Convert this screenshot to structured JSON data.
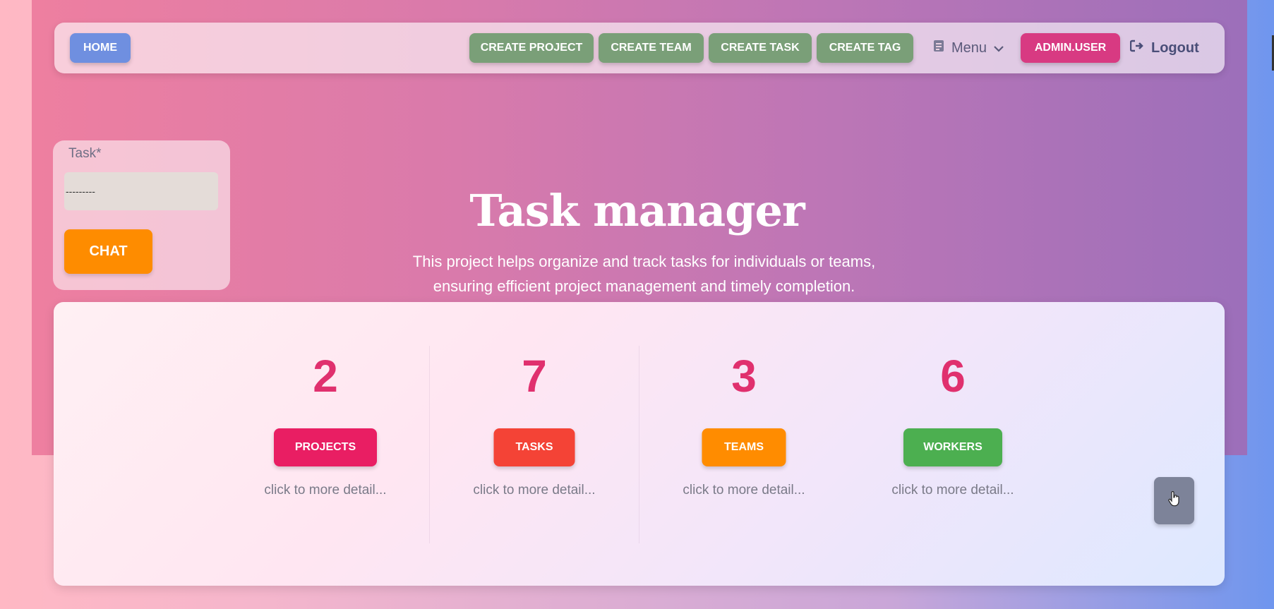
{
  "nav": {
    "home_label": "HOME",
    "actions": [
      "CREATE PROJECT",
      "CREATE TEAM",
      "CREATE TASK",
      "CREATE TAG"
    ],
    "menu_label": "Menu",
    "user_label": "ADMIN.USER",
    "logout_label": "Logout"
  },
  "chat": {
    "task_label": "Task*",
    "task_value": "---------",
    "chat_button": "CHAT"
  },
  "hero": {
    "title": "Task manager",
    "subtitle_line1": "This project helps organize and track tasks for individuals or teams,",
    "subtitle_line2": "ensuring efficient project management and timely completion."
  },
  "stats": [
    {
      "value": "2",
      "label": "PROJECTS",
      "detail": "click to more detail...",
      "color": "#e91e63"
    },
    {
      "value": "7",
      "label": "TASKS",
      "detail": "click to more detail...",
      "color": "#f44336"
    },
    {
      "value": "3",
      "label": "TEAMS",
      "detail": "click to more detail...",
      "color": "#ff8c00"
    },
    {
      "value": "6",
      "label": "WORKERS",
      "detail": "click to more detail...",
      "color": "#4caf50"
    }
  ],
  "colors": {
    "accent_number": "#e0306e",
    "nav_green": "#7a9f78",
    "home_blue": "#6f8fe0",
    "admin_pink": "#d83a82",
    "chat_orange": "#fe8c00"
  },
  "icons": {
    "menu": "document-icon",
    "menu_chevron": "chevron-down-icon",
    "logout": "sign-out-icon",
    "cursor": "hand-pointer-icon"
  }
}
